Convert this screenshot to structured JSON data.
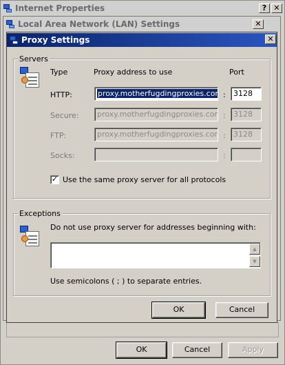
{
  "windows": {
    "internet_properties": {
      "title": "Internet Properties",
      "help_btn": "?",
      "close_btn": "✕",
      "buttons": {
        "ok": "OK",
        "cancel": "Cancel",
        "apply": "Apply"
      }
    },
    "lan_settings": {
      "title": "Local Area Network (LAN) Settings",
      "close_btn": "✕"
    },
    "proxy_settings": {
      "title": "Proxy Settings",
      "close_btn": "✕",
      "servers_group": {
        "legend": "Servers",
        "col_type": "Type",
        "col_address": "Proxy address to use",
        "col_port": "Port",
        "separator": ":",
        "rows": [
          {
            "type": "HTTP:",
            "address": "proxy.motherfugdingproxies.com",
            "port": "3128",
            "enabled": true
          },
          {
            "type": "Secure:",
            "address": "proxy.motherfugdingproxies.com",
            "port": "3128",
            "enabled": false
          },
          {
            "type": "FTP:",
            "address": "proxy.motherfugdingproxies.com",
            "port": "3128",
            "enabled": false
          },
          {
            "type": "Socks:",
            "address": "",
            "port": "",
            "enabled": false
          }
        ],
        "same_proxy_label": "Use the same proxy server for all protocols",
        "same_proxy_checked": true
      },
      "exceptions_group": {
        "legend": "Exceptions",
        "instruction": "Do not use proxy server for addresses beginning with:",
        "exceptions_value": "",
        "hint": "Use semicolons ( ; ) to separate entries."
      },
      "buttons": {
        "ok": "OK",
        "cancel": "Cancel"
      }
    }
  },
  "colors": {
    "face": "#d4d0c8",
    "active_title": "#0a246a",
    "inactive_title": "#d0d0d0",
    "selection": "#0a246a"
  }
}
